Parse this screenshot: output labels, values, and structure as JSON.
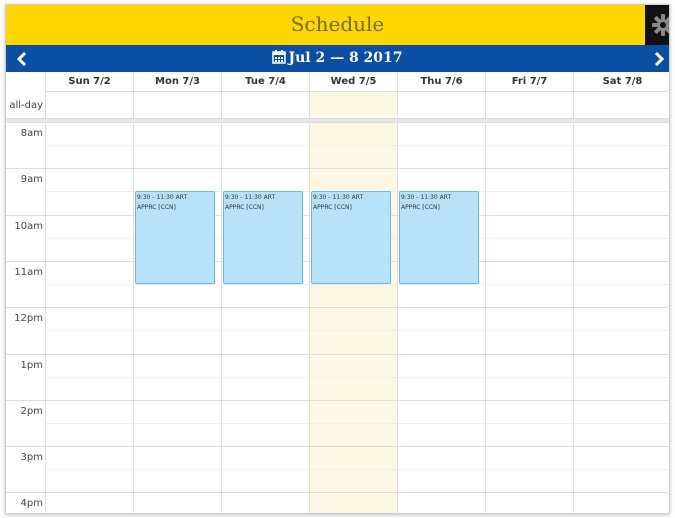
{
  "header": {
    "title": "Schedule"
  },
  "nav": {
    "range": "Jul 2 — 8 2017"
  },
  "allday_label": "all-day",
  "days": [
    {
      "label": "Sun 7/2"
    },
    {
      "label": "Mon 7/3"
    },
    {
      "label": "Tue 7/4"
    },
    {
      "label": "Wed 7/5",
      "today": true
    },
    {
      "label": "Thu 7/6"
    },
    {
      "label": "Fri 7/7"
    },
    {
      "label": "Sat 7/8"
    }
  ],
  "hours": [
    "8am",
    "9am",
    "10am",
    "11am",
    "12pm",
    "1pm",
    "2pm",
    "3pm",
    "4pm"
  ],
  "events": [
    {
      "day": 1,
      "start": 9.5,
      "end": 11.5,
      "time": "9:30 - 11:30",
      "title": "ART",
      "subtitle": "APPRC [CCN]"
    },
    {
      "day": 2,
      "start": 9.5,
      "end": 11.5,
      "time": "9:30 - 11:30",
      "title": "ART",
      "subtitle": "APPRC [CCN]"
    },
    {
      "day": 3,
      "start": 9.5,
      "end": 11.5,
      "time": "9:30 - 11:30",
      "title": "ART",
      "subtitle": "APPRC [CCN]"
    },
    {
      "day": 4,
      "start": 9.5,
      "end": 11.5,
      "time": "9:30 - 11:30",
      "title": "ART",
      "subtitle": "APPRC [CCN]"
    }
  ],
  "colors": {
    "header_bg": "#ffd700",
    "nav_bg": "#0a4fa3",
    "event_bg": "#b8e2f9",
    "event_border": "#6db8e0",
    "today_bg": "#fcf8e3"
  }
}
